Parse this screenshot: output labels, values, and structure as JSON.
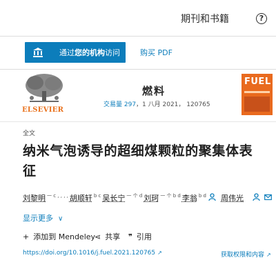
{
  "header": {
    "nav_title": "期刊和书籍",
    "help_icon": "?"
  },
  "access": {
    "button_label_pre": "通过",
    "button_label_bold": "您的机构",
    "button_label_post": "访问",
    "buy_pdf": "购买 PDF"
  },
  "journal": {
    "publisher": "ELSEVIER",
    "name": "燃料",
    "volume_link": "交易量 297",
    "date_pages": "，1 八月 2021， 120765",
    "cover_word": "FUEL"
  },
  "article": {
    "type": "全文",
    "title": "纳米气泡诱导的超细煤颗粒的聚集体表征",
    "authors": [
      {
        "name": "刘黎明",
        "sup": "一 c , , , ,"
      },
      {
        "name": "胡顺轩",
        "sup": "b c"
      },
      {
        "name": "吴长宁",
        "sup": "一 个 d"
      },
      {
        "name": "刘珂",
        "sup": "一 个 b d"
      },
      {
        "name": "李翁",
        "sup": "b d"
      },
      {
        "name": "周伟光",
        "sup": ""
      }
    ],
    "show_more": "显示更多"
  },
  "actions": {
    "add_to": "添加到 Mendeley",
    "share": "共享",
    "cite": "引用"
  },
  "links": {
    "doi": "https://doi.org/10.1016/j.fuel.2021.120765",
    "rights": "获取权限和内容"
  },
  "colors": {
    "accent": "#0c7dbb",
    "publisher_orange": "#e9711c",
    "cover_orange": "#e96a1e"
  }
}
